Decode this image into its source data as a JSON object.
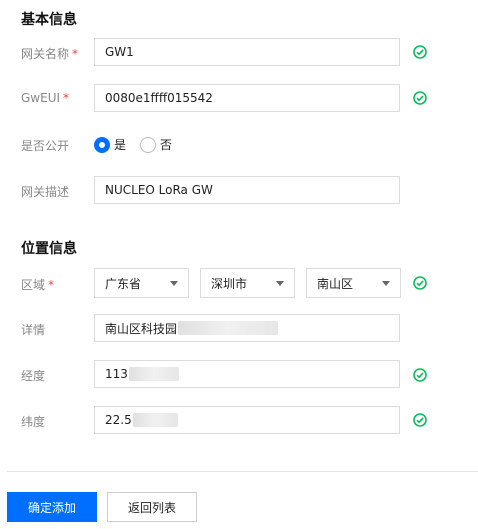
{
  "basic": {
    "title": "基本信息",
    "gateway_name": {
      "label": "网关名称",
      "value": "GW1",
      "required": "*"
    },
    "gweui": {
      "label": "GwEUI",
      "value": "0080e1ffff015542",
      "required": "*"
    },
    "is_public": {
      "label": "是否公开",
      "options": [
        "是",
        "否"
      ],
      "selected": "是"
    },
    "description": {
      "label": "网关描述",
      "value": "NUCLEO LoRa GW"
    }
  },
  "location": {
    "title": "位置信息",
    "region": {
      "label": "区域",
      "required": "*",
      "province": "广东省",
      "city": "深圳市",
      "district": "南山区"
    },
    "detail": {
      "label": "详情",
      "value": "南山区科技园"
    },
    "longitude": {
      "label": "经度",
      "value": "113"
    },
    "latitude": {
      "label": "纬度",
      "value": "22.5"
    }
  },
  "actions": {
    "confirm": "确定添加",
    "back": "返回列表"
  },
  "colors": {
    "primary": "#006eff",
    "success": "#0abf5b",
    "required": "#e54545"
  }
}
